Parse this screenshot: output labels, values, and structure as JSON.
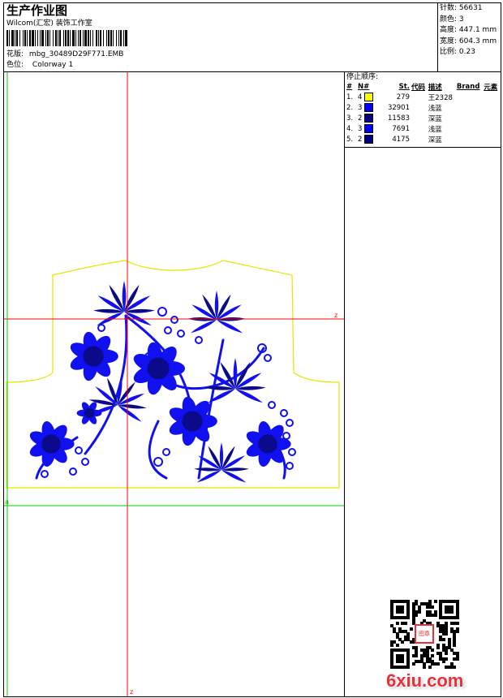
{
  "header": {
    "title": "生产作业图",
    "company": "Wilcom(汇宏) 装饰工作室",
    "design_label": "花版:",
    "design_value": "mbg_30489D29F771.EMB",
    "colorway_label": "色位:",
    "colorway_value": "Colorway 1"
  },
  "stats": [
    {
      "label": "针数:",
      "value": "56631"
    },
    {
      "label": "颜色:",
      "value": "3"
    },
    {
      "label": "高度:",
      "value": "447.1 mm"
    },
    {
      "label": "宽度:",
      "value": "604.3 mm"
    },
    {
      "label": "比例:",
      "value": "0.23"
    }
  ],
  "stop_sequence": {
    "title": "停止顺序:",
    "headers": [
      "#",
      "N#",
      "St.",
      "代码",
      "描述",
      "Brand",
      "元素"
    ],
    "rows": [
      {
        "num": "1.",
        "n": "4",
        "color": "#ffff00",
        "stitches": "279",
        "code": "",
        "desc": "王2328"
      },
      {
        "num": "2.",
        "n": "3",
        "color": "#0000ff",
        "stitches": "32901",
        "code": "",
        "desc": "浅蓝"
      },
      {
        "num": "3.",
        "n": "2",
        "color": "#000080",
        "stitches": "11583",
        "code": "",
        "desc": "深蓝"
      },
      {
        "num": "4.",
        "n": "3",
        "color": "#0000ff",
        "stitches": "7691",
        "code": "",
        "desc": "浅蓝"
      },
      {
        "num": "5.",
        "n": "2",
        "color": "#000080",
        "stitches": "4175",
        "code": "",
        "desc": "深蓝"
      }
    ]
  },
  "axis_marks": {
    "right": "z",
    "bottom": "z",
    "left": "a"
  },
  "watermark": {
    "site": "6xiu.com",
    "seal": "图章"
  },
  "colors": {
    "outline": "#e6e600",
    "axis_red": "#ff0000",
    "axis_green": "#00cc00",
    "embroidery_light": "#1010f0",
    "embroidery_dark": "#0a0a8a",
    "watermark_red": "#e8303a"
  }
}
